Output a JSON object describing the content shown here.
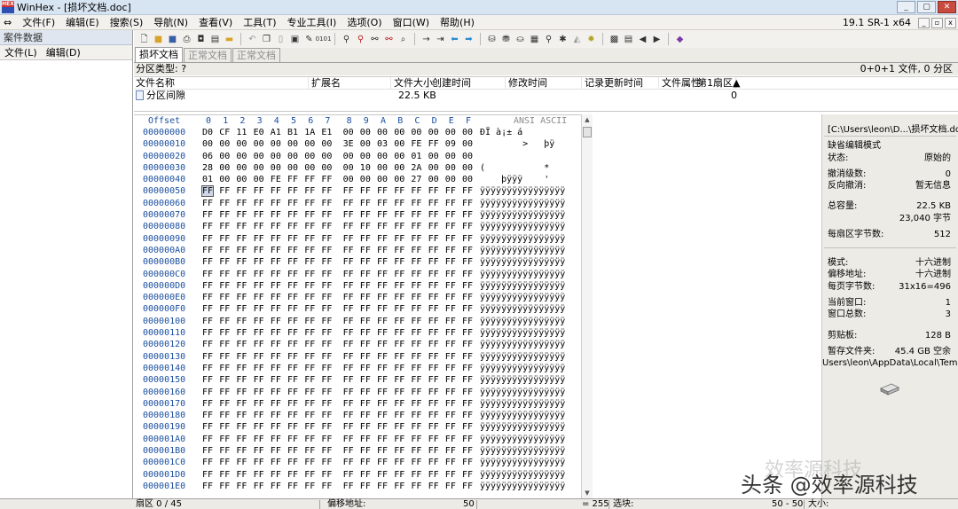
{
  "window": {
    "title": "WinHex - [损坏文档.doc]",
    "logo_text": "HEX",
    "version": "19.1 SR-1 x64",
    "buttons": [
      "_",
      "▢",
      "✕"
    ],
    "mdi_buttons": [
      "_",
      "▫",
      "x"
    ]
  },
  "menu": [
    "文件(F)",
    "编辑(E)",
    "搜索(S)",
    "导航(N)",
    "查看(V)",
    "工具(T)",
    "专业工具(I)",
    "选项(O)",
    "窗口(W)",
    "帮助(H)"
  ],
  "left_panel": {
    "title": "案件数据",
    "menu": [
      "文件(L)",
      "编辑(D)"
    ]
  },
  "toolbar": {
    "icons": [
      "new-icon",
      "open-icon",
      "save-icon",
      "print-icon",
      "properties-icon",
      "options-icon",
      "undo-icon",
      "copy-icon",
      "paste-icon",
      "clipboard-icon",
      "write-icon",
      "hex-icon",
      "find-icon",
      "find-hex-icon",
      "replace-icon",
      "replace-hex-icon",
      "goto-icon",
      "goto-offset-icon",
      "back-icon",
      "forward-icon",
      "disk-icon",
      "ram-icon",
      "calc-icon",
      "hex-view-icon",
      "search-disk-icon",
      "tools-icon",
      "script-icon",
      "gear-icon",
      "table-icon",
      "list-icon",
      "prev-icon",
      "next-icon",
      "bookmark-icon"
    ]
  },
  "tabs": [
    "损坏文档",
    "正常文档",
    "正常文档"
  ],
  "strip": {
    "partition_type": "分区类型: ?",
    "summary": "0+0+1 文件, 0 分区"
  },
  "dir": {
    "headers": [
      "文件名称",
      "扩展名",
      "文件大小",
      "创建时间",
      "修改时间",
      "记录更新时间",
      "文件属性",
      "第1扇区▲"
    ],
    "rows": [
      {
        "name": "分区间隙",
        "size": "22.5 KB",
        "sector": "0"
      }
    ]
  },
  "hex": {
    "offset_label": "Offset",
    "columns": [
      "0",
      "1",
      "2",
      "3",
      "4",
      "5",
      "6",
      "7",
      "8",
      "9",
      "A",
      "B",
      "C",
      "D",
      "E",
      "F"
    ],
    "ascii_label": "ANSI ASCII",
    "rows": [
      {
        "offset": "00000000",
        "bytes": [
          "D0",
          "CF",
          "11",
          "E0",
          "A1",
          "B1",
          "1A",
          "E1",
          "00",
          "00",
          "00",
          "00",
          "00",
          "00",
          "00",
          "00"
        ],
        "ascii": "ÐÏ à¡± á"
      },
      {
        "offset": "00000010",
        "bytes": [
          "00",
          "00",
          "00",
          "00",
          "00",
          "00",
          "00",
          "00",
          "3E",
          "00",
          "03",
          "00",
          "FE",
          "FF",
          "09",
          "00"
        ],
        "ascii": "        >   þÿ"
      },
      {
        "offset": "00000020",
        "bytes": [
          "06",
          "00",
          "00",
          "00",
          "00",
          "00",
          "00",
          "00",
          "00",
          "00",
          "00",
          "00",
          "01",
          "00",
          "00",
          "00"
        ],
        "ascii": ""
      },
      {
        "offset": "00000030",
        "bytes": [
          "28",
          "00",
          "00",
          "00",
          "00",
          "00",
          "00",
          "00",
          "00",
          "10",
          "00",
          "00",
          "2A",
          "00",
          "00",
          "00"
        ],
        "ascii": "(           *"
      },
      {
        "offset": "00000040",
        "bytes": [
          "01",
          "00",
          "00",
          "00",
          "FE",
          "FF",
          "FF",
          "FF",
          "00",
          "00",
          "00",
          "00",
          "27",
          "00",
          "00",
          "00"
        ],
        "ascii": "    þÿÿÿ    '"
      },
      {
        "offset": "00000050",
        "bytes": [
          "FF",
          "FF",
          "FF",
          "FF",
          "FF",
          "FF",
          "FF",
          "FF",
          "FF",
          "FF",
          "FF",
          "FF",
          "FF",
          "FF",
          "FF",
          "FF"
        ],
        "ascii": "ÿÿÿÿÿÿÿÿÿÿÿÿÿÿÿÿ"
      },
      {
        "offset": "00000060",
        "bytes": [
          "FF",
          "FF",
          "FF",
          "FF",
          "FF",
          "FF",
          "FF",
          "FF",
          "FF",
          "FF",
          "FF",
          "FF",
          "FF",
          "FF",
          "FF",
          "FF"
        ],
        "ascii": "ÿÿÿÿÿÿÿÿÿÿÿÿÿÿÿÿ"
      },
      {
        "offset": "00000070",
        "bytes": [
          "FF",
          "FF",
          "FF",
          "FF",
          "FF",
          "FF",
          "FF",
          "FF",
          "FF",
          "FF",
          "FF",
          "FF",
          "FF",
          "FF",
          "FF",
          "FF"
        ],
        "ascii": "ÿÿÿÿÿÿÿÿÿÿÿÿÿÿÿÿ"
      },
      {
        "offset": "00000080",
        "bytes": [
          "FF",
          "FF",
          "FF",
          "FF",
          "FF",
          "FF",
          "FF",
          "FF",
          "FF",
          "FF",
          "FF",
          "FF",
          "FF",
          "FF",
          "FF",
          "FF"
        ],
        "ascii": "ÿÿÿÿÿÿÿÿÿÿÿÿÿÿÿÿ"
      },
      {
        "offset": "00000090",
        "bytes": [
          "FF",
          "FF",
          "FF",
          "FF",
          "FF",
          "FF",
          "FF",
          "FF",
          "FF",
          "FF",
          "FF",
          "FF",
          "FF",
          "FF",
          "FF",
          "FF"
        ],
        "ascii": "ÿÿÿÿÿÿÿÿÿÿÿÿÿÿÿÿ"
      },
      {
        "offset": "000000A0",
        "bytes": [
          "FF",
          "FF",
          "FF",
          "FF",
          "FF",
          "FF",
          "FF",
          "FF",
          "FF",
          "FF",
          "FF",
          "FF",
          "FF",
          "FF",
          "FF",
          "FF"
        ],
        "ascii": "ÿÿÿÿÿÿÿÿÿÿÿÿÿÿÿÿ"
      },
      {
        "offset": "000000B0",
        "bytes": [
          "FF",
          "FF",
          "FF",
          "FF",
          "FF",
          "FF",
          "FF",
          "FF",
          "FF",
          "FF",
          "FF",
          "FF",
          "FF",
          "FF",
          "FF",
          "FF"
        ],
        "ascii": "ÿÿÿÿÿÿÿÿÿÿÿÿÿÿÿÿ"
      },
      {
        "offset": "000000C0",
        "bytes": [
          "FF",
          "FF",
          "FF",
          "FF",
          "FF",
          "FF",
          "FF",
          "FF",
          "FF",
          "FF",
          "FF",
          "FF",
          "FF",
          "FF",
          "FF",
          "FF"
        ],
        "ascii": "ÿÿÿÿÿÿÿÿÿÿÿÿÿÿÿÿ"
      },
      {
        "offset": "000000D0",
        "bytes": [
          "FF",
          "FF",
          "FF",
          "FF",
          "FF",
          "FF",
          "FF",
          "FF",
          "FF",
          "FF",
          "FF",
          "FF",
          "FF",
          "FF",
          "FF",
          "FF"
        ],
        "ascii": "ÿÿÿÿÿÿÿÿÿÿÿÿÿÿÿÿ"
      },
      {
        "offset": "000000E0",
        "bytes": [
          "FF",
          "FF",
          "FF",
          "FF",
          "FF",
          "FF",
          "FF",
          "FF",
          "FF",
          "FF",
          "FF",
          "FF",
          "FF",
          "FF",
          "FF",
          "FF"
        ],
        "ascii": "ÿÿÿÿÿÿÿÿÿÿÿÿÿÿÿÿ"
      },
      {
        "offset": "000000F0",
        "bytes": [
          "FF",
          "FF",
          "FF",
          "FF",
          "FF",
          "FF",
          "FF",
          "FF",
          "FF",
          "FF",
          "FF",
          "FF",
          "FF",
          "FF",
          "FF",
          "FF"
        ],
        "ascii": "ÿÿÿÿÿÿÿÿÿÿÿÿÿÿÿÿ"
      },
      {
        "offset": "00000100",
        "bytes": [
          "FF",
          "FF",
          "FF",
          "FF",
          "FF",
          "FF",
          "FF",
          "FF",
          "FF",
          "FF",
          "FF",
          "FF",
          "FF",
          "FF",
          "FF",
          "FF"
        ],
        "ascii": "ÿÿÿÿÿÿÿÿÿÿÿÿÿÿÿÿ"
      },
      {
        "offset": "00000110",
        "bytes": [
          "FF",
          "FF",
          "FF",
          "FF",
          "FF",
          "FF",
          "FF",
          "FF",
          "FF",
          "FF",
          "FF",
          "FF",
          "FF",
          "FF",
          "FF",
          "FF"
        ],
        "ascii": "ÿÿÿÿÿÿÿÿÿÿÿÿÿÿÿÿ"
      },
      {
        "offset": "00000120",
        "bytes": [
          "FF",
          "FF",
          "FF",
          "FF",
          "FF",
          "FF",
          "FF",
          "FF",
          "FF",
          "FF",
          "FF",
          "FF",
          "FF",
          "FF",
          "FF",
          "FF"
        ],
        "ascii": "ÿÿÿÿÿÿÿÿÿÿÿÿÿÿÿÿ"
      },
      {
        "offset": "00000130",
        "bytes": [
          "FF",
          "FF",
          "FF",
          "FF",
          "FF",
          "FF",
          "FF",
          "FF",
          "FF",
          "FF",
          "FF",
          "FF",
          "FF",
          "FF",
          "FF",
          "FF"
        ],
        "ascii": "ÿÿÿÿÿÿÿÿÿÿÿÿÿÿÿÿ"
      },
      {
        "offset": "00000140",
        "bytes": [
          "FF",
          "FF",
          "FF",
          "FF",
          "FF",
          "FF",
          "FF",
          "FF",
          "FF",
          "FF",
          "FF",
          "FF",
          "FF",
          "FF",
          "FF",
          "FF"
        ],
        "ascii": "ÿÿÿÿÿÿÿÿÿÿÿÿÿÿÿÿ"
      },
      {
        "offset": "00000150",
        "bytes": [
          "FF",
          "FF",
          "FF",
          "FF",
          "FF",
          "FF",
          "FF",
          "FF",
          "FF",
          "FF",
          "FF",
          "FF",
          "FF",
          "FF",
          "FF",
          "FF"
        ],
        "ascii": "ÿÿÿÿÿÿÿÿÿÿÿÿÿÿÿÿ"
      },
      {
        "offset": "00000160",
        "bytes": [
          "FF",
          "FF",
          "FF",
          "FF",
          "FF",
          "FF",
          "FF",
          "FF",
          "FF",
          "FF",
          "FF",
          "FF",
          "FF",
          "FF",
          "FF",
          "FF"
        ],
        "ascii": "ÿÿÿÿÿÿÿÿÿÿÿÿÿÿÿÿ"
      },
      {
        "offset": "00000170",
        "bytes": [
          "FF",
          "FF",
          "FF",
          "FF",
          "FF",
          "FF",
          "FF",
          "FF",
          "FF",
          "FF",
          "FF",
          "FF",
          "FF",
          "FF",
          "FF",
          "FF"
        ],
        "ascii": "ÿÿÿÿÿÿÿÿÿÿÿÿÿÿÿÿ"
      },
      {
        "offset": "00000180",
        "bytes": [
          "FF",
          "FF",
          "FF",
          "FF",
          "FF",
          "FF",
          "FF",
          "FF",
          "FF",
          "FF",
          "FF",
          "FF",
          "FF",
          "FF",
          "FF",
          "FF"
        ],
        "ascii": "ÿÿÿÿÿÿÿÿÿÿÿÿÿÿÿÿ"
      },
      {
        "offset": "00000190",
        "bytes": [
          "FF",
          "FF",
          "FF",
          "FF",
          "FF",
          "FF",
          "FF",
          "FF",
          "FF",
          "FF",
          "FF",
          "FF",
          "FF",
          "FF",
          "FF",
          "FF"
        ],
        "ascii": "ÿÿÿÿÿÿÿÿÿÿÿÿÿÿÿÿ"
      },
      {
        "offset": "000001A0",
        "bytes": [
          "FF",
          "FF",
          "FF",
          "FF",
          "FF",
          "FF",
          "FF",
          "FF",
          "FF",
          "FF",
          "FF",
          "FF",
          "FF",
          "FF",
          "FF",
          "FF"
        ],
        "ascii": "ÿÿÿÿÿÿÿÿÿÿÿÿÿÿÿÿ"
      },
      {
        "offset": "000001B0",
        "bytes": [
          "FF",
          "FF",
          "FF",
          "FF",
          "FF",
          "FF",
          "FF",
          "FF",
          "FF",
          "FF",
          "FF",
          "FF",
          "FF",
          "FF",
          "FF",
          "FF"
        ],
        "ascii": "ÿÿÿÿÿÿÿÿÿÿÿÿÿÿÿÿ"
      },
      {
        "offset": "000001C0",
        "bytes": [
          "FF",
          "FF",
          "FF",
          "FF",
          "FF",
          "FF",
          "FF",
          "FF",
          "FF",
          "FF",
          "FF",
          "FF",
          "FF",
          "FF",
          "FF",
          "FF"
        ],
        "ascii": "ÿÿÿÿÿÿÿÿÿÿÿÿÿÿÿÿ"
      },
      {
        "offset": "000001D0",
        "bytes": [
          "FF",
          "FF",
          "FF",
          "FF",
          "FF",
          "FF",
          "FF",
          "FF",
          "FF",
          "FF",
          "FF",
          "FF",
          "FF",
          "FF",
          "FF",
          "FF"
        ],
        "ascii": "ÿÿÿÿÿÿÿÿÿÿÿÿÿÿÿÿ"
      },
      {
        "offset": "000001E0",
        "bytes": [
          "FF",
          "FF",
          "FF",
          "FF",
          "FF",
          "FF",
          "FF",
          "FF",
          "FF",
          "FF",
          "FF",
          "FF",
          "FF",
          "FF",
          "FF",
          "FF"
        ],
        "ascii": "ÿÿÿÿÿÿÿÿÿÿÿÿÿÿÿÿ"
      }
    ]
  },
  "info": {
    "path": "[C:\\Users\\leon\\D...\\损坏文档.doc]",
    "edit_mode": "缺省编辑模式",
    "state_label": "状态:",
    "state_value": "原始的",
    "undo_level_label": "撤消级数:",
    "undo_level_value": "0",
    "reverse_undo_label": "反向撤消:",
    "reverse_undo_value": "暂无信息",
    "total_label": "总容量:",
    "total_value": "22.5 KB",
    "total_bytes": "23,040 字节",
    "bytes_per_sector_label": "每扇区字节数:",
    "bytes_per_sector_value": "512",
    "mode_label": "模式:",
    "mode_value": "十六进制",
    "offset_label": "偏移地址:",
    "offset_value": "十六进制",
    "bytes_per_page_label": "每页字节数:",
    "bytes_per_page_value": "31x16=496",
    "current_window_label": "当前窗口:",
    "current_window_value": "1",
    "window_count_label": "窗口总数:",
    "window_count_value": "3",
    "clipboard_label": "剪贴板:",
    "clipboard_value": "128 B",
    "temp_label": "暂存文件夹:",
    "temp_value": "45.4 GB 空余",
    "temp_path": "Users\\leon\\AppData\\Local\\Temp"
  },
  "status": {
    "sector": "扇区 0 / 45",
    "offset_label": "偏移地址:",
    "offset_value": "50",
    "value": "= 255",
    "block_label": "选块:",
    "block_value": "50 - 50",
    "size_label": "大小:"
  },
  "watermark": {
    "text": "头条 @效率源科技",
    "ghost": "效率源科技"
  }
}
